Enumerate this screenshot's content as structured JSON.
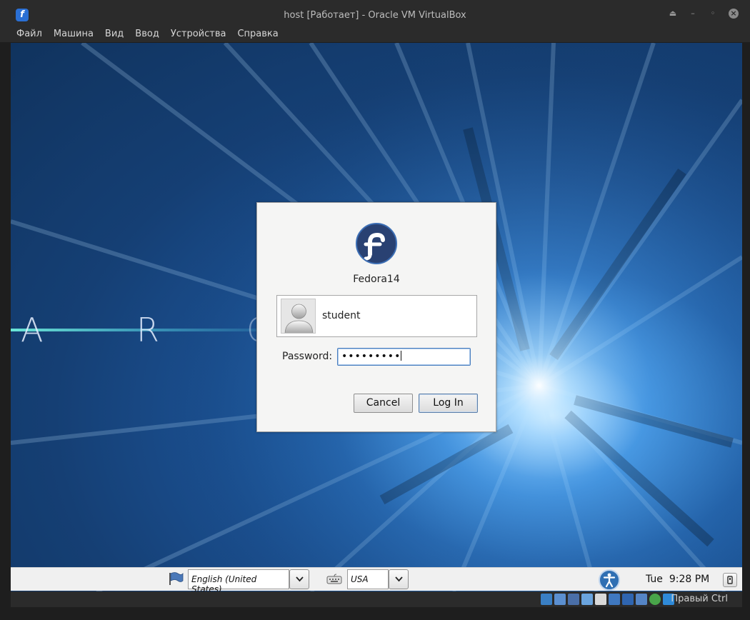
{
  "window": {
    "title": "host [Работает] - Oracle VM VirtualBox",
    "app_icon_glyph": "f"
  },
  "menubar": {
    "items": [
      "Файл",
      "Машина",
      "Вид",
      "Ввод",
      "Устройства",
      "Справка"
    ]
  },
  "wallpaper": {
    "letters": [
      "A",
      "R",
      "C"
    ]
  },
  "login": {
    "host_name": "Fedora14",
    "user": "student",
    "password_label": "Password:",
    "password_masked": "•••••••••",
    "cancel_label": "Cancel",
    "login_label": "Log In"
  },
  "panel": {
    "language": "English (United States)",
    "keyboard_layout": "USA",
    "day": "Tue",
    "time": "9:28 PM"
  },
  "statusbar": {
    "host_key": "Правый Ctrl",
    "icons": [
      "hdd-icon",
      "optical-icon",
      "network-icon",
      "usb-icon",
      "shared-folders-icon",
      "display-icon",
      "video-capture-icon",
      "cpu-icon",
      "mouse-integration-icon",
      "keyboard-capture-icon"
    ]
  },
  "colors": {
    "chrome": "#2b2b2b",
    "accent": "#2a6fd4",
    "fedora_blue": "#294172"
  }
}
